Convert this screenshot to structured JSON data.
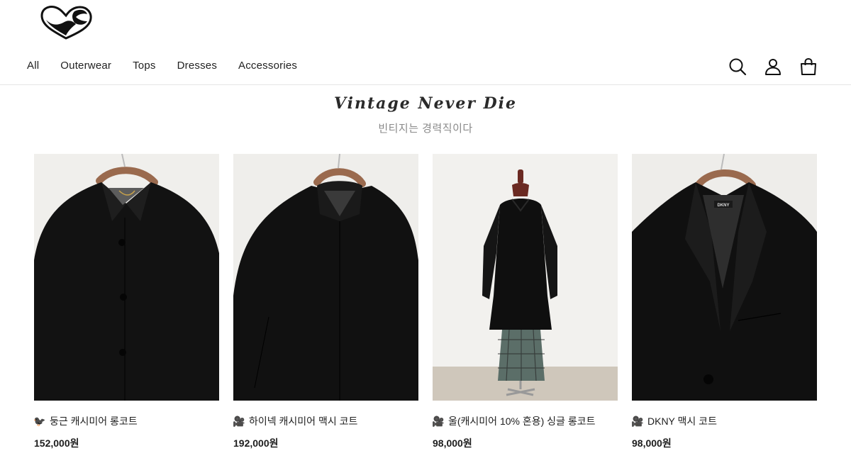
{
  "header": {
    "logo": "brand-logo",
    "nav": [
      "All",
      "Outerwear",
      "Tops",
      "Dresses",
      "Accessories"
    ],
    "icons": [
      "search-icon",
      "account-icon",
      "cart-icon"
    ]
  },
  "hero": {
    "headline": "Vintage Never Die",
    "subline": "빈티지는 경력직이다"
  },
  "products": [
    {
      "emoji": "🐦‍⬛",
      "name": "둥근 캐시미어 롱코트",
      "price": "152,000원"
    },
    {
      "emoji": "🎥",
      "name": "하이넥 캐시미어 맥시 코트",
      "price": "192,000원"
    },
    {
      "emoji": "🎥",
      "name": "울(캐시미어 10% 혼용) 싱글 롱코트",
      "price": "98,000원"
    },
    {
      "emoji": "🎥",
      "name": "DKNY 맥시 코트",
      "price": "98,000원"
    }
  ]
}
